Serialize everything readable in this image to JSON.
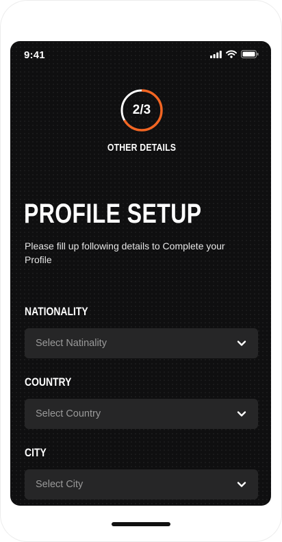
{
  "status": {
    "time": "9:41"
  },
  "progress": {
    "label": "2/3",
    "fraction": 0.6667,
    "ring_color": "#f26522"
  },
  "step": {
    "title": "OTHER DETAILS"
  },
  "page": {
    "title": "PROFILE SETUP",
    "subtitle": "Please fill up following details to Complete your Profile"
  },
  "fields": [
    {
      "label": "NATIONALITY",
      "placeholder": "Select Natinality"
    },
    {
      "label": "COUNTRY",
      "placeholder": "Select Country"
    },
    {
      "label": "CITY",
      "placeholder": "Select City"
    }
  ]
}
